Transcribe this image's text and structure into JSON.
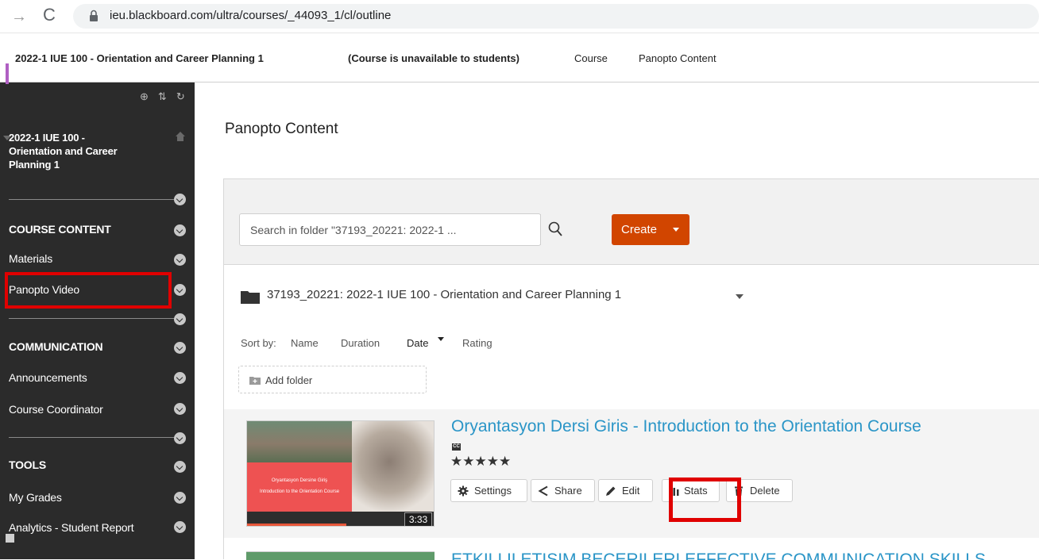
{
  "browser": {
    "url": "ieu.blackboard.com/ultra/courses/_44093_1/cl/outline"
  },
  "course_header": {
    "title": "2022-1 IUE 100 - Orientation and Career Planning 1",
    "availability": "(Course is unavailable to students)",
    "links": [
      "Course",
      "Panopto Content"
    ]
  },
  "sidebar": {
    "course_title_lines": [
      "2022-1 IUE 100 -",
      "Orientation and Career",
      "Planning 1"
    ],
    "sections": [
      {
        "heading": "COURSE CONTENT",
        "items": [
          "Materials",
          "Panopto Video"
        ]
      },
      {
        "heading": "COMMUNICATION",
        "items": [
          "Announcements",
          "Course Coordinator"
        ]
      },
      {
        "heading": "TOOLS",
        "items": [
          "My Grades",
          "Analytics - Student Report"
        ]
      }
    ]
  },
  "main": {
    "page_title": "Panopto Content",
    "search": {
      "placeholder": "Search in folder \"37193_20221: 2022-1 ..."
    },
    "create_label": "Create",
    "folder_name": "37193_20221: 2022-1 IUE 100 - Orientation and Career Planning 1",
    "sort": {
      "label": "Sort by:",
      "options": [
        "Name",
        "Duration",
        "Date",
        "Rating"
      ],
      "active": "Date"
    },
    "add_folder_label": "Add folder",
    "sessions": [
      {
        "title": "Oryantasyon Dersi Giris - Introduction to the Orientation Course",
        "cc": "CC",
        "stars": "★★★★★",
        "duration": "3:33",
        "watched_fraction": 0.53,
        "thumb_text_1": "Oryantasyon Dersine Giriş",
        "thumb_text_2": "Introduction to the Orientation Course",
        "actions": [
          "Settings",
          "Share",
          "Edit",
          "Stats",
          "Delete"
        ]
      },
      {
        "title": "ETKILI ILETISIM BECERILERI EFFECTIVE COMMUNICATION SKILLS"
      }
    ]
  },
  "colors": {
    "sidebar_bg": "#2b2b2b",
    "create_button": "#d14500",
    "link_blue": "#2a95c7",
    "highlight_red": "#e00000"
  }
}
